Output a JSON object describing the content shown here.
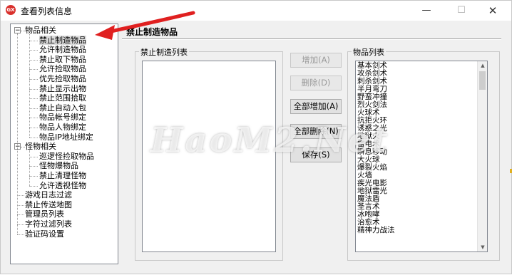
{
  "window": {
    "title": "查看列表信息",
    "icon": "app-icon",
    "app_icon_text": "GX",
    "controls": {
      "minimize": "—",
      "maximize": "☐",
      "close": "✕"
    }
  },
  "tree": {
    "groups": [
      {
        "label": "物品相关",
        "expanded": true,
        "children": [
          "禁止制造物品",
          "允许制造物品",
          "禁止取下物品",
          "允许捡取物品",
          "优先捡取物品",
          "禁止显示出物",
          "禁止范围拾取",
          "禁止自动入包",
          "物品帐号绑定",
          "物品人物绑定",
          "物品IP地址绑定"
        ]
      },
      {
        "label": "怪物相关",
        "expanded": true,
        "children": [
          "巡逻怪捡取物品",
          "怪物爆物品",
          "禁止清理怪物",
          "允许透视怪物"
        ]
      }
    ],
    "items": [
      "游戏日志过滤",
      "禁止传送地图",
      "管理员列表",
      "字符过滤列表",
      "验证码设置"
    ],
    "selected": "禁止制造物品"
  },
  "panel": {
    "title": "禁止制造物品",
    "left_group": {
      "label": "禁止制造列表",
      "items": []
    },
    "right_group": {
      "label": "物品列表",
      "items": [
        "基本剑术",
        "攻杀剑术",
        "刺杀剑术",
        "半月弯刀",
        "野蛮冲撞",
        "烈火剑法",
        "火球术",
        "抗拒火环",
        "诱惑之光",
        "地狱火",
        "雷电术",
        "瞬息移动",
        "大火球",
        "爆裂火焰",
        "火墙",
        "疾光电影",
        "地狱雷光",
        "魔法盾",
        "圣言术",
        "冰咆哮",
        "治愈术",
        "精神力战法"
      ]
    },
    "buttons": {
      "add": "增加(A)",
      "delete": "删除(D)",
      "add_all": "全部增加(A)",
      "delete_all": "全部删除(N)",
      "save": "保存(S)"
    }
  },
  "watermark": "HaoM2.Net",
  "colors": {
    "arrow": "#e02020",
    "selection": "#dcdcdc",
    "app_icon": "#d9302c"
  }
}
